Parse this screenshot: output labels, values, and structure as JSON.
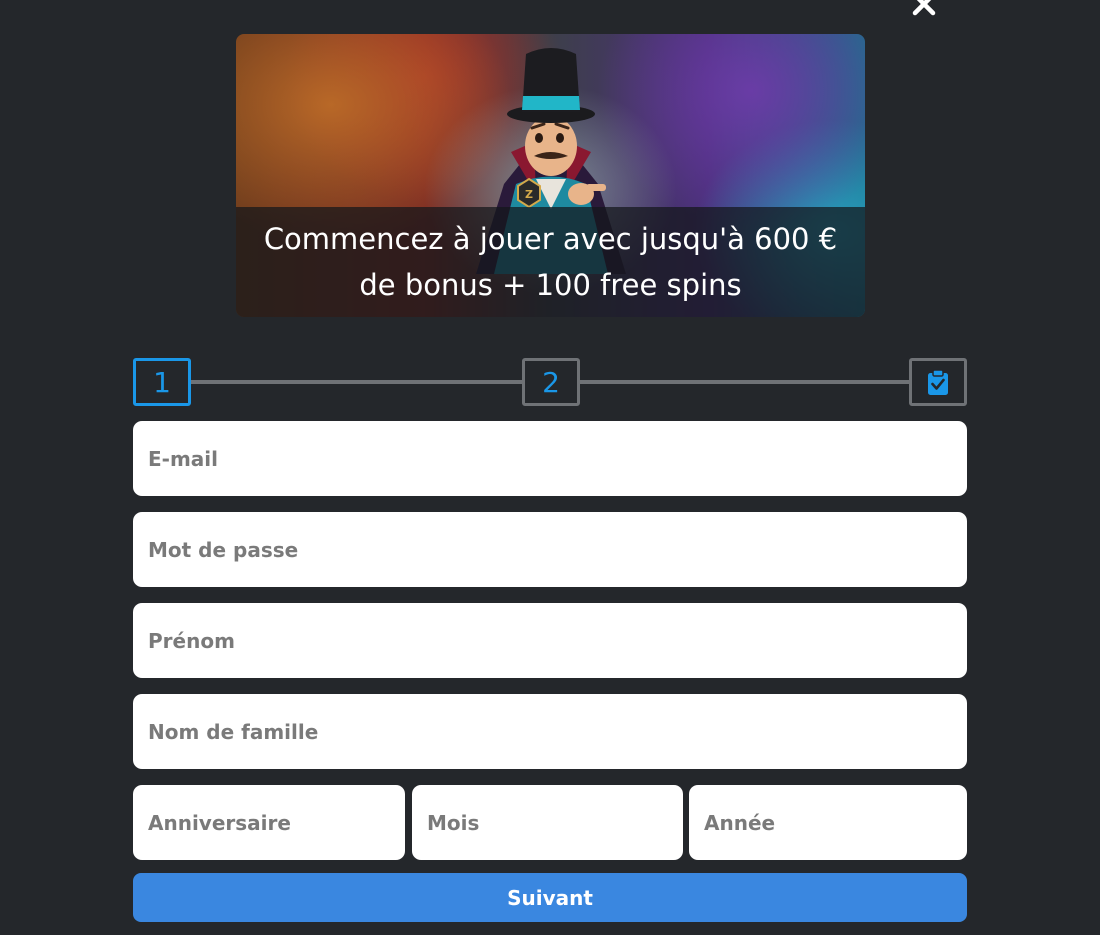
{
  "dialog": {
    "close_icon": "close-icon"
  },
  "banner": {
    "image_alt_icon": "magician-mascot-illustration",
    "caption": "Commencez à jouer avec jusqu'à 600 € de bonus + 100 free spins"
  },
  "stepper": {
    "steps": [
      {
        "label": "1",
        "state": "active"
      },
      {
        "label": "2",
        "state": "inactive"
      },
      {
        "label": "",
        "icon": "clipboard-check-icon",
        "state": "inactive"
      }
    ],
    "active_color": "#1a97e8",
    "inactive_color": "#6f7276"
  },
  "form": {
    "email_placeholder": "E-mail",
    "password_placeholder": "Mot de passe",
    "firstname_placeholder": "Prénom",
    "lastname_placeholder": "Nom de famille",
    "birth_day_placeholder": "Anniversaire",
    "birth_month_placeholder": "Mois",
    "birth_year_placeholder": "Année",
    "submit_label": "Suivant"
  },
  "colors": {
    "background": "#24272b",
    "submit": "#3a87e0"
  }
}
